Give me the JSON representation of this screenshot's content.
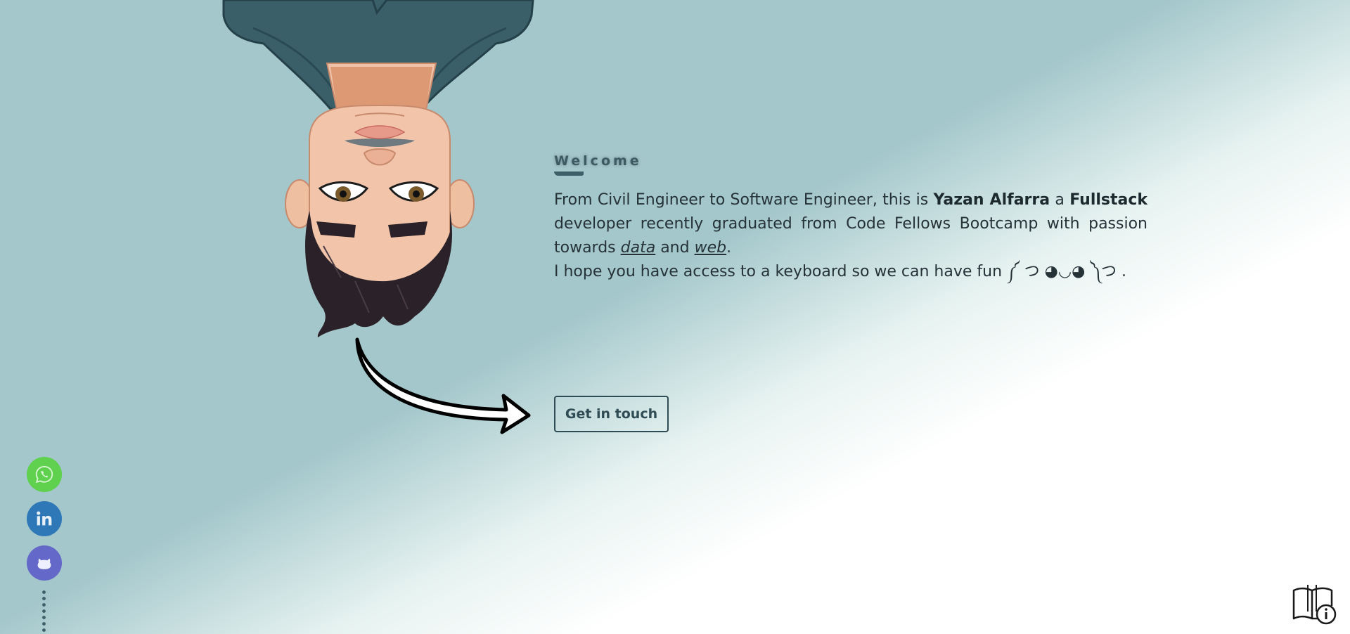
{
  "intro": {
    "welcome": "Welcome",
    "bio": {
      "part1": "From Civil Engineer to Software Engineer, this is ",
      "name": "Yazan Alfarra",
      "part2": " a ",
      "role": "Fullstack",
      "part3": " developer recently graduated from Code Fellows Bootcamp with passion towards ",
      "interest1": "data",
      "part4": " and ",
      "interest2": "web",
      "part5": "."
    },
    "keyboard_line": "I hope you have access to a keyboard so we can have fun ༼ つ ◕◡◕ ༽つ ."
  },
  "cta": {
    "label": "Get in touch"
  },
  "social": [
    {
      "name": "whatsapp",
      "icon": "whatsapp-icon",
      "color": "#5fd14e"
    },
    {
      "name": "linkedin",
      "icon": "linkedin-icon",
      "color": "#2f78b8"
    },
    {
      "name": "github",
      "icon": "github-icon",
      "color": "#6468c8"
    }
  ],
  "colors": {
    "background_teal": "#a4c7cb",
    "accent_dark": "#2f4b53"
  },
  "icons": {
    "avatar": "upside-down-avatar-illustration",
    "arrow": "curved-arrow-icon",
    "guide": "book-info-icon"
  }
}
